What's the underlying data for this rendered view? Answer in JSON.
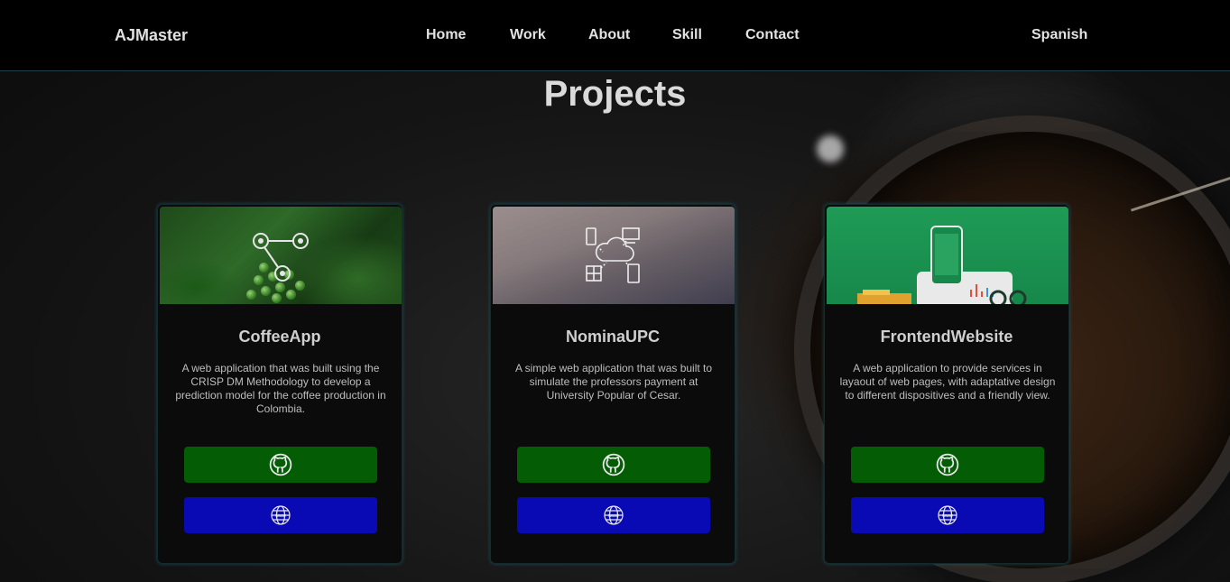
{
  "nav": {
    "brand": "AJMaster",
    "links": [
      "Home",
      "Work",
      "About",
      "Skill",
      "Contact"
    ],
    "language": "Spanish"
  },
  "section": {
    "title": "Projects"
  },
  "projects": [
    {
      "title": "CoffeeApp",
      "description": "A web application that was built using the CRISP DM Methodology to develop a prediction model for the coffee production in Colombia.",
      "github_icon": "github-icon",
      "web_icon": "globe-www-icon"
    },
    {
      "title": "NominaUPC",
      "description": "A simple web application that was built to simulate the professors payment at University Popular of Cesar.",
      "github_icon": "github-icon",
      "web_icon": "globe-www-icon"
    },
    {
      "title": "FrontendWebsite",
      "description": "A web application to provide services in layaout of web pages, with adaptative design to different dispositives and a friendly view.",
      "github_icon": "github-icon",
      "web_icon": "globe-www-icon"
    }
  ],
  "colors": {
    "github_button": "#045c04",
    "web_button": "#0a0ab4",
    "navbar": "#000000"
  }
}
